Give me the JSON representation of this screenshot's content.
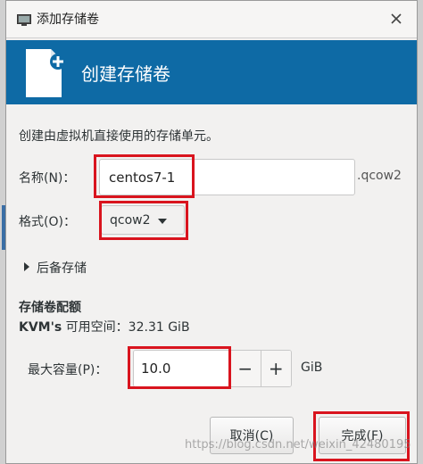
{
  "window": {
    "title": "添加存储卷",
    "app_icon": "virt-manager-icon",
    "close_icon": "close-icon"
  },
  "banner": {
    "title": "创建存储卷",
    "icon": "document-plus-icon",
    "color": "#0e6aa5"
  },
  "form": {
    "description": "创建由虚拟机直接使用的存储单元。",
    "name_label": "名称(N)：",
    "name_value": "centos7-1",
    "name_suffix": ".qcow2",
    "format_label": "格式(O)：",
    "format_value": "qcow2",
    "backing_label": "后备存储",
    "section_title": "存储卷配额",
    "avail_prefix": "KVM's",
    "avail_text": " 可用空间：32.31 GiB",
    "capacity_label": "最大容量(P)：",
    "capacity_value": "10.0",
    "minus_label": "−",
    "plus_label": "+",
    "unit": "GiB"
  },
  "buttons": {
    "cancel": "取消(C)",
    "finish": "完成(F)"
  },
  "watermark": "https://blog.csdn.net/weixin_42480195",
  "highlight_color": "#d9141e"
}
